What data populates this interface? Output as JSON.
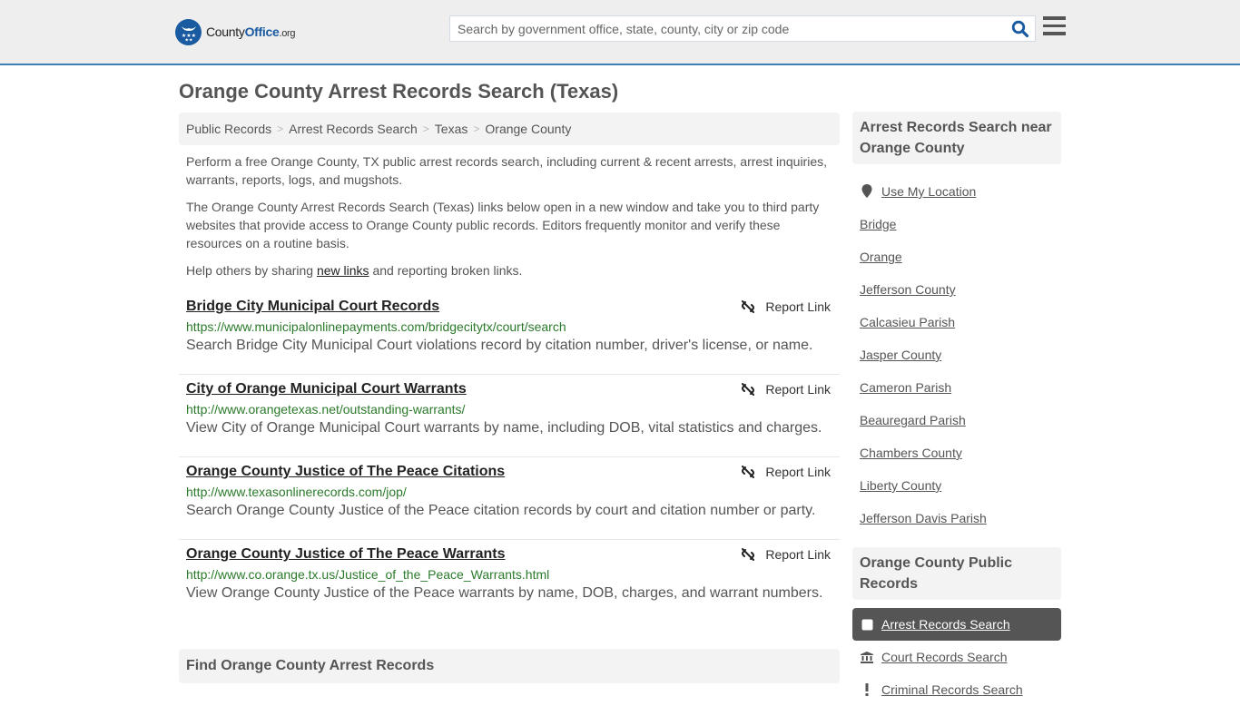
{
  "header": {
    "logo": {
      "brand_pre": "County",
      "brand_bold": "Office",
      "brand_suffix": ".org"
    },
    "search": {
      "placeholder": "Search by government office, state, county, city or zip code",
      "value": ""
    },
    "icons": {
      "search": "search-icon",
      "menu": "hamburger-menu-icon"
    }
  },
  "page": {
    "title": "Orange County Arrest Records Search (Texas)"
  },
  "breadcrumb": [
    {
      "label": "Public Records"
    },
    {
      "label": "Arrest Records Search"
    },
    {
      "label": "Texas"
    },
    {
      "label": "Orange County"
    }
  ],
  "intro": {
    "p1": "Perform a free Orange County, TX public arrest records search, including current & recent arrests, arrest inquiries, warrants, reports, logs, and mugshots.",
    "p2": "The Orange County Arrest Records Search (Texas) links below open in a new window and take you to third party websites that provide access to Orange County public records. Editors frequently monitor and verify these resources on a routine basis.",
    "p3_pre": "Help others by sharing ",
    "p3_link": "new links",
    "p3_post": " and reporting broken links."
  },
  "links": [
    {
      "title": "Bridge City Municipal Court Records",
      "url": "https://www.municipalonlinepayments.com/bridgecitytx/court/search",
      "desc": "Search Bridge City Municipal Court violations record by citation number, driver's license, or name.",
      "report": "Report Link"
    },
    {
      "title": "City of Orange Municipal Court Warrants",
      "url": "http://www.orangetexas.net/outstanding-warrants/",
      "desc": "View City of Orange Municipal Court warrants by name, including DOB, vital statistics and charges.",
      "report": "Report Link"
    },
    {
      "title": "Orange County Justice of The Peace Citations",
      "url": "http://www.texasonlinerecords.com/jop/",
      "desc": "Search Orange County Justice of the Peace citation records by court and citation number or party.",
      "report": "Report Link"
    },
    {
      "title": "Orange County Justice of The Peace Warrants",
      "url": "http://www.co.orange.tx.us/Justice_of_the_Peace_Warrants.html",
      "desc": "View Orange County Justice of the Peace warrants by name, DOB, charges, and warrant numbers.",
      "report": "Report Link"
    }
  ],
  "find_section": {
    "title": "Find Orange County Arrest Records"
  },
  "sidebar": {
    "nearby": {
      "title": "Arrest Records Search near Orange County",
      "use_location": "Use My Location",
      "items": [
        "Bridge",
        "Orange",
        "Jefferson County",
        "Calcasieu Parish",
        "Jasper County",
        "Cameron Parish",
        "Beauregard Parish",
        "Chambers County",
        "Liberty County",
        "Jefferson Davis Parish"
      ]
    },
    "public_records": {
      "title": "Orange County Public Records",
      "items": [
        {
          "label": "Arrest Records Search",
          "icon": "square-icon",
          "active": true
        },
        {
          "label": "Court Records Search",
          "icon": "courthouse-icon",
          "active": false
        },
        {
          "label": "Criminal Records Search",
          "icon": "exclamation-icon",
          "active": false
        }
      ]
    }
  },
  "colors": {
    "accent_border": "#3d7fb3",
    "brand_blue": "#1a5aa0",
    "url_green": "#2b7a2b",
    "active_bg": "#555555"
  }
}
